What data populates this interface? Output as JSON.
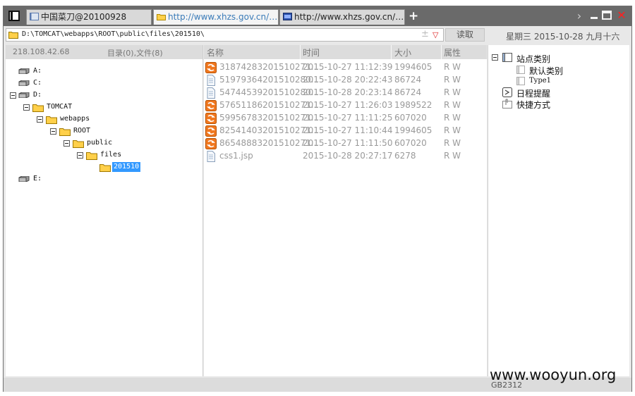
{
  "tabs": [
    {
      "label": "中国菜刀@20100928"
    },
    {
      "label": "http://www.xhzs.gov.cn/publi..."
    },
    {
      "label": "http://www.xhzs.gov.cn/publi..."
    }
  ],
  "address": {
    "path": "D:\\TOMCAT\\webapps\\ROOT\\public\\files\\201510\\",
    "read_label": "读取",
    "date_label": "星期三 2015-10-28 九月十六"
  },
  "left": {
    "ip": "218.108.42.68",
    "summary": "目录(0),文件(8)",
    "tree": [
      {
        "label": "A:"
      },
      {
        "label": "C:"
      },
      {
        "label": "D:"
      },
      {
        "label": "TOMCAT"
      },
      {
        "label": "webapps"
      },
      {
        "label": "ROOT"
      },
      {
        "label": "public"
      },
      {
        "label": "files"
      },
      {
        "label": "201510"
      },
      {
        "label": "E:"
      }
    ]
  },
  "files": {
    "headers": {
      "name": "名称",
      "time": "时间",
      "size": "大小",
      "attr": "属性"
    },
    "rows": [
      {
        "name": "31874283201510271...",
        "time": "2015-10-27 11:12:39",
        "size": "1994605",
        "attr": "R W",
        "icon": "image-icon"
      },
      {
        "name": "51979364201510280...",
        "time": "2015-10-28 20:22:43",
        "size": "86724",
        "attr": "R W",
        "icon": "file-icon"
      },
      {
        "name": "54744539201510280...",
        "time": "2015-10-28 20:23:14",
        "size": "86724",
        "attr": "R W",
        "icon": "file-icon"
      },
      {
        "name": "57651186201510271...",
        "time": "2015-10-27 11:26:03",
        "size": "1989522",
        "attr": "R W",
        "icon": "image-icon"
      },
      {
        "name": "59956783201510271...",
        "time": "2015-10-27 11:11:25",
        "size": "607020",
        "attr": "R W",
        "icon": "image-icon"
      },
      {
        "name": "82541403201510271...",
        "time": "2015-10-27 11:10:44",
        "size": "1994605",
        "attr": "R W",
        "icon": "image-icon"
      },
      {
        "name": "86548883201510271...",
        "time": "2015-10-27 11:11:50",
        "size": "607020",
        "attr": "R W",
        "icon": "image-icon"
      },
      {
        "name": "css1.jsp",
        "time": "2015-10-28 20:27:17",
        "size": "6278",
        "attr": "R W",
        "icon": "file-icon"
      }
    ]
  },
  "right": {
    "site_category": "站点类别",
    "default_category": "默认类别",
    "type1": "Type1",
    "reminder": "日程提醒",
    "shortcut": "快捷方式"
  },
  "status": {
    "encoding": "GB2312"
  },
  "watermark": "www.wooyun.org"
}
